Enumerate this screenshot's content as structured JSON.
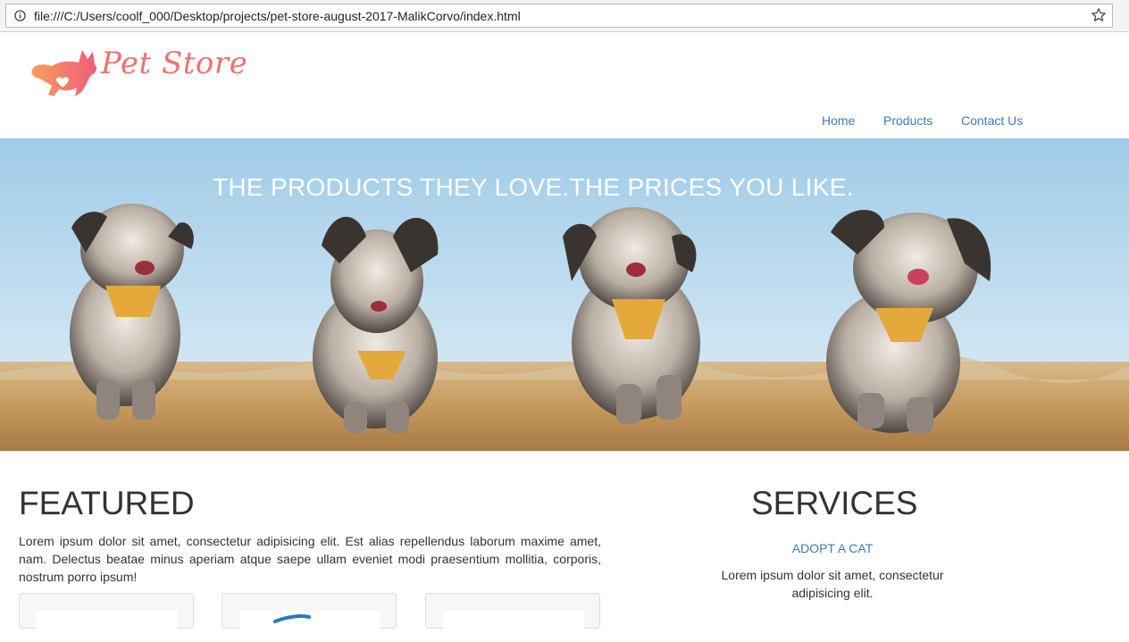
{
  "browser": {
    "url": "file:///C:/Users/coolf_000/Desktop/projects/pet-store-august-2017-MalikCorvo/index.html"
  },
  "header": {
    "logo_text": "Pet Store",
    "brand_color": "#f0716f",
    "nav": [
      {
        "label": "Home"
      },
      {
        "label": "Products"
      },
      {
        "label": "Contact Us"
      }
    ]
  },
  "hero": {
    "title": "THE PRODUCTS THEY LOVE.THE PRICES YOU LIKE."
  },
  "featured": {
    "heading": "FEATURED",
    "text": "Lorem ipsum dolor sit amet, consectetur adipisicing elit. Est alias repellendus laborum maxime amet, nam. Delectus beatae minus aperiam atque saepe ullam eveniet modi praesentium mollitia, corporis, nostrum porro ipsum!"
  },
  "services": {
    "heading": "SERVICES",
    "item_title": "ADOPT A CAT",
    "item_text": "Lorem ipsum dolor sit amet, consectetur adipisicing elit."
  },
  "colors": {
    "link": "#3f7ab6",
    "text": "#333333"
  }
}
